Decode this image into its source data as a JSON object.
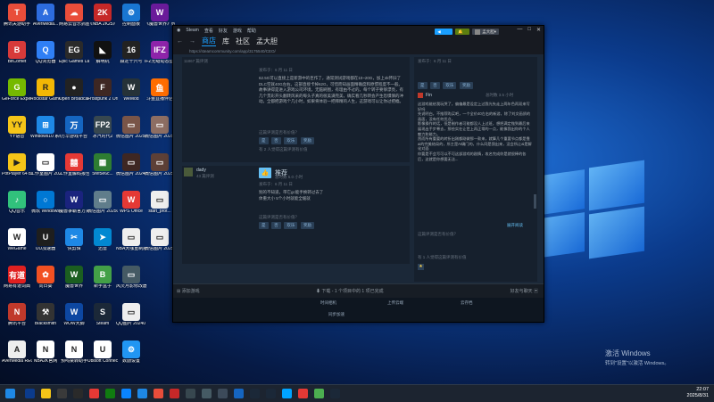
{
  "desktop_icons": [
    {
      "label": "腾讯关游助手",
      "color": "#e94d3a",
      "glyph": "T"
    },
    {
      "label": "BitComet",
      "color": "#d73a3a",
      "glyph": "B"
    },
    {
      "label": "GeForce Experience",
      "color": "#76b900",
      "glyph": "G"
    },
    {
      "label": "YY语音",
      "color": "#f5c518",
      "glyph": "YY"
    },
    {
      "label": "PotPlayer 64 bit",
      "color": "#f5c518",
      "glyph": "▶"
    },
    {
      "label": "QQ音乐",
      "color": "#31c27c",
      "glyph": "♪"
    },
    {
      "label": "WeGame",
      "color": "#ffffff",
      "glyph": "W"
    },
    {
      "label": "网易有道词典",
      "color": "#e02020",
      "glyph": "有道"
    },
    {
      "label": "腾讯平台",
      "color": "#c0392b",
      "glyph": "N"
    },
    {
      "label": "AVerMedia RECentral 4",
      "color": "#eeeeee",
      "glyph": "A"
    },
    {
      "label": "AVerMedia...",
      "color": "#2d6cdf",
      "glyph": "A"
    },
    {
      "label": "QQ浏览器",
      "color": "#2f7ff5",
      "glyph": "Q"
    },
    {
      "label": "Rockstar Games...",
      "color": "#f2b705",
      "glyph": "R"
    },
    {
      "label": "Windows10 系统激活工具",
      "color": "#1e88e5",
      "glyph": "⊞"
    },
    {
      "label": "工作室图片 2023011...",
      "color": "#ffffff",
      "glyph": "▭"
    },
    {
      "label": "微软 Windows",
      "color": "#0078d4",
      "glyph": "○"
    },
    {
      "label": "UU加速器",
      "color": "#1e1e1e",
      "glyph": "U"
    },
    {
      "label": "向日葵",
      "color": "#f25022",
      "glyph": "✿"
    },
    {
      "label": "Blacksmith",
      "color": "#333333",
      "glyph": "⚒"
    },
    {
      "label": "NBA2K官网",
      "color": "#ffffff",
      "glyph": "N"
    },
    {
      "label": "网易云音乐抓图器",
      "color": "#e94d3a",
      "glyph": "☁"
    },
    {
      "label": "Epic Games Launcher",
      "color": "#2a2a2a",
      "glyph": "EG"
    },
    {
      "label": "Open Broadcast...",
      "color": "#222222",
      "glyph": "●"
    },
    {
      "label": "万华游戏平台",
      "color": "#1565c0",
      "glyph": "万"
    },
    {
      "label": "工作室解码报告",
      "color": "#e53935",
      "glyph": "囍"
    },
    {
      "label": "魔兽争霸官方对战平台",
      "color": "#1a237e",
      "glyph": "W"
    },
    {
      "label": "快剪辑",
      "color": "#1e88e5",
      "glyph": "✂"
    },
    {
      "label": "魔兽世界",
      "color": "#1b5e20",
      "glyph": "W"
    },
    {
      "label": "WOW大脚",
      "color": "#0d47a1",
      "glyph": "W"
    },
    {
      "label": "预吗桌转助手",
      "color": "#ffffff",
      "glyph": "N"
    },
    {
      "label": "《NBA 2K25》",
      "color": "#c62828",
      "glyph": "2K"
    },
    {
      "label": "解明机",
      "color": "#111111",
      "glyph": "◣"
    },
    {
      "label": "Frostpunk 2 Original S...",
      "color": "#3e2723",
      "glyph": "F"
    },
    {
      "label": "冰汽时代2",
      "color": "#37474f",
      "glyph": "FP2"
    },
    {
      "label": "5fef5e6c...",
      "color": "#2e7d32",
      "glyph": "▦"
    },
    {
      "label": "微信图片 20250...",
      "color": "#607d8b",
      "glyph": "▭"
    },
    {
      "label": "迅雷",
      "color": "#0288d1",
      "glyph": "➤"
    },
    {
      "label": "新手盒子",
      "color": "#43a047",
      "glyph": "B"
    },
    {
      "label": "Steam",
      "color": "#1b2838",
      "glyph": "S"
    },
    {
      "label": "Ubisoft Connect",
      "color": "#ffffff",
      "glyph": "U"
    },
    {
      "label": "控制面板",
      "color": "#1976d2",
      "glyph": "⚙"
    },
    {
      "label": "森定十六号",
      "color": "#222222",
      "glyph": "16"
    },
    {
      "label": "WeMod",
      "color": "#263238",
      "glyph": "W"
    },
    {
      "label": "微信图片 20250...",
      "color": "#795548",
      "glyph": "▭"
    },
    {
      "label": "微信图片 20241001...",
      "color": "#3e2723",
      "glyph": "▭"
    },
    {
      "label": "WPS Office",
      "color": "#e53935",
      "glyph": "W"
    },
    {
      "label": "NBA大咖重制版V9",
      "color": "#eeeeee",
      "glyph": "▭"
    },
    {
      "label": "风灵月影修改器",
      "color": "#455a64",
      "glyph": "▭"
    },
    {
      "label": "QQ图片 202407...",
      "color": "#eeeeee",
      "glyph": "▭"
    },
    {
      "label": "数励设置",
      "color": "#2196f3",
      "glyph": "⚙"
    },
    {
      "label": "《魔兽世界》经典怀旧服",
      "color": "#6a1b9a",
      "glyph": "W"
    },
    {
      "label": "IFZ无缝动态壁纸软件",
      "color": "#8e24aa",
      "glyph": "IFZ"
    },
    {
      "label": "斗鱼直播伴侣",
      "color": "#ff6d00",
      "glyph": "鱼"
    },
    {
      "label": "微信图片 2025032...",
      "color": "#8d6e63",
      "glyph": "▭"
    },
    {
      "label": "微信图片 2025040...",
      "color": "#5d4037",
      "glyph": "▭"
    },
    {
      "label": "start_prot...",
      "color": "#eeeeee",
      "glyph": "▭"
    },
    {
      "label": "微信图片 20250...",
      "color": "#eeeeee",
      "glyph": "▭"
    }
  ],
  "steam": {
    "title_menu": [
      "Steam",
      "查看",
      "好友",
      "游戏",
      "帮助"
    ],
    "nav_tabs": [
      "商店",
      "库",
      "社区",
      "孟大胆"
    ],
    "username": "孟大胆",
    "url": "https://steamcommunity.com/app/3175540/CEO/",
    "review1": {
      "header": "11867 篇评测",
      "date": "发布于：6 月 11 日",
      "text": "62.5G可以直接上是新游中的巨作了，通常测试游戏都在10~20G，加上4k怀旧了DLC空就40G左右。这部直接卡掉62G，可惜而知画面精确度和原惯程度不一般。故事讲得是进入游戏公司环境，无脑刷图，有理由不过的。每个转子要够漂亮，有几个贯彩开头翻转风采的每头子真的很美满完美，确实看几秒转会产生恐惧慎的冲动。全都把游戏个几小时，如果将体验一把拜精的人生，这游戏可以让你过把瘾。",
      "helpful": "这篇评测是否有价值？",
      "buttons": [
        "是",
        "否",
        "欢乐",
        "奖励"
      ],
      "found": "有 2 人觉得这篇评测有价值"
    },
    "review2": {
      "user": "dady",
      "sub": "43 篇评测",
      "rec": "推荐",
      "hours": "总时数 5.0 小时",
      "date": "发布于：6 月 11 日",
      "text": "别的不知道，带它gc能手换转过去了\n体重大小 5个小时就能全缓就",
      "helpful": "这篇评测是否有价值？",
      "buttons": [
        "是",
        "否",
        "欢乐",
        "奖励"
      ]
    },
    "right_col": {
      "date": "发布于：6 月 11 日",
      "btns": [
        "是",
        "否",
        "欢乐",
        "奖励"
      ],
      "user": "Fin",
      "hours": "总时数 3.5 小时",
      "text": "这游戏能给我玩哭了，偏偏最是设定上过我光先走上两年色再双来写好吗\n先说明白，不推荐购买吧，一个全价40左右的新游，除了刘文画质的画面，没有任何优点。\n影像操作的话，但是制作者可能都没人上过班，想把满定抛到最后来展现出手步脊去，那些实在让世上再正常的一点，能像我出你的个人魅力和能力。\n然而所有重要的转折出刚都刚做那一款来，就算几个重要节点都是靠ai的完美结局的，所主是AI确门的，什么同是我出来，没会所让ai是解化对面\n你要是不会写可以不可这部游戏的剧情，攻名完成你是就很棒的各后，这就是你想要无法...",
      "expand": "展开阅读",
      "helpful": "这篇评测是否有价值？",
      "found": "有 1 人觉得这篇评测有价值"
    },
    "footer_left": "添加游戏",
    "footer_mid": "下载 - 1 个项目中的 1 项已完成",
    "footer_right": "好友与聊天",
    "bottom_items": [
      "时间相机",
      "上传云端",
      "云存档",
      "同步加速"
    ]
  },
  "watermark": {
    "line1": "激活 Windows",
    "line2": "转到\"设置\"以激活 Windows。"
  },
  "tray": {
    "time": "22:07",
    "date": "2025/8/31"
  }
}
